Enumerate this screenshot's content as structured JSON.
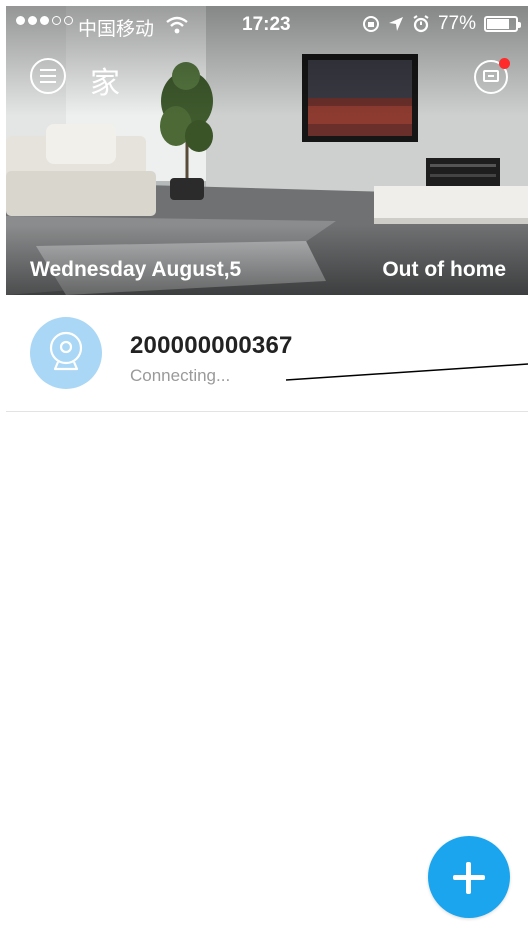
{
  "status_bar": {
    "carrier": "中国移动",
    "time": "17:23",
    "battery": "77%",
    "battery_level": 0.77,
    "signal_icon": "signal-dots-icon",
    "wifi_icon": "wifi-icon",
    "orientation_lock_icon": "orientation-lock-icon",
    "location_icon": "location-arrow-icon",
    "alarm_icon": "alarm-icon"
  },
  "header": {
    "title": "家",
    "menu_icon": "menu-icon",
    "message_icon": "message-icon",
    "has_notification": true,
    "date": "Wednesday August,5",
    "mode": "Out of home"
  },
  "devices": [
    {
      "name": "200000000367",
      "status": "Connecting...",
      "icon": "camera-icon"
    }
  ],
  "fab": {
    "icon": "plus-icon"
  },
  "colors": {
    "accent": "#1aa5ee",
    "avatar_bg": "#a9d7f5",
    "notification": "#ff2a2a",
    "status_text": "#9a9a9a"
  }
}
